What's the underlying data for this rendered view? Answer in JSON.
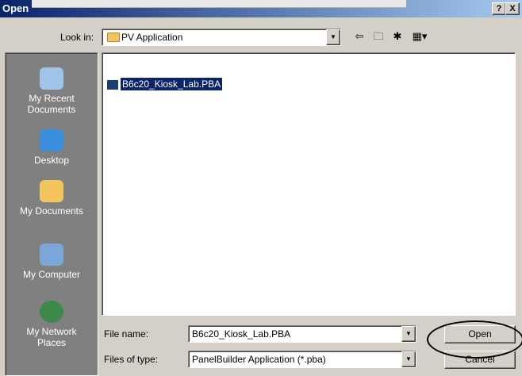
{
  "window": {
    "title": "Open",
    "help_button": "?",
    "close_button": "X"
  },
  "toolbar": {
    "look_in_label": "Look in:",
    "look_in_value": "PV Application",
    "look_in_icon": "folder-icon",
    "tools": [
      {
        "name": "back-icon",
        "glyph": "⇦"
      },
      {
        "name": "up-folder-icon",
        "glyph": "🗀"
      },
      {
        "name": "new-folder-icon",
        "glyph": "✱"
      },
      {
        "name": "view-menu-icon",
        "glyph": "▦▾"
      }
    ]
  },
  "places": [
    {
      "label_lines": [
        "My Recent",
        "Documents"
      ],
      "icon": "recent-documents-icon",
      "color": "#9ec4ea"
    },
    {
      "label_lines": [
        "Desktop"
      ],
      "icon": "desktop-icon",
      "color": "#3a8edb"
    },
    {
      "label_lines": [
        "My Documents"
      ],
      "icon": "my-documents-icon",
      "color": "#f2c55c"
    },
    {
      "label_lines": [
        "My Computer"
      ],
      "icon": "my-computer-icon",
      "color": "#7aa6d8"
    },
    {
      "label_lines": [
        "My Network",
        "Places"
      ],
      "icon": "network-places-icon",
      "color": "#3b8a4a"
    }
  ],
  "file_list": {
    "items": [
      {
        "name": "B6c20_Kiosk_Lab.PBA",
        "selected": true,
        "icon": "pba-file-icon"
      }
    ]
  },
  "form": {
    "file_name_label": "File name:",
    "file_name_value": "B6c20_Kiosk_Lab.PBA",
    "file_type_label": "Files of type:",
    "file_type_value": "PanelBuilder Application (*.pba)",
    "open_button": "Open",
    "cancel_button": "Cancel"
  },
  "colors": {
    "title_bar": "#0a246a",
    "selection": "#0a246a",
    "dialog_face": "#d4d0c8",
    "places_bar": "#808080"
  }
}
